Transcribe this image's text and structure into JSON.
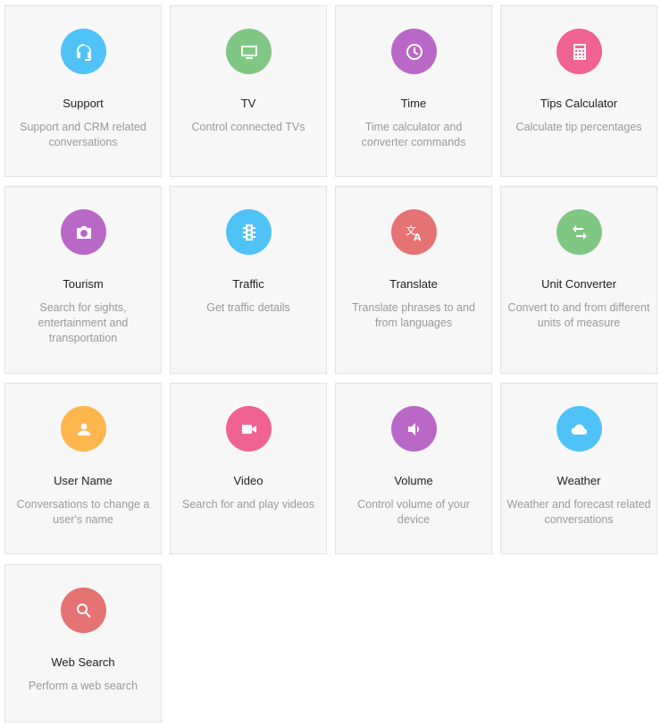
{
  "cards": [
    {
      "title": "Support",
      "description": "Support and CRM related conversations",
      "icon": "headset-icon",
      "color": "#4fc3f7"
    },
    {
      "title": "TV",
      "description": "Control connected TVs",
      "icon": "tv-icon",
      "color": "#81c784"
    },
    {
      "title": "Time",
      "description": "Time calculator and converter commands",
      "icon": "clock-icon",
      "color": "#ba68c8"
    },
    {
      "title": "Tips Calculator",
      "description": "Calculate tip percentages",
      "icon": "calculator-icon",
      "color": "#f06292"
    },
    {
      "title": "Tourism",
      "description": "Search for sights, entertainment and transportation",
      "icon": "camera-icon",
      "color": "#ba68c8"
    },
    {
      "title": "Traffic",
      "description": "Get traffic details",
      "icon": "traffic-light-icon",
      "color": "#4fc3f7"
    },
    {
      "title": "Translate",
      "description": "Translate phrases to and from languages",
      "icon": "translate-icon",
      "color": "#e57373"
    },
    {
      "title": "Unit Converter",
      "description": "Convert to and from different units of measure",
      "icon": "swap-arrows-icon",
      "color": "#81c784"
    },
    {
      "title": "User Name",
      "description": "Conversations to change a user's name",
      "icon": "person-icon",
      "color": "#ffb74d"
    },
    {
      "title": "Video",
      "description": "Search for and play videos",
      "icon": "video-camera-icon",
      "color": "#f06292"
    },
    {
      "title": "Volume",
      "description": "Control volume of your device",
      "icon": "speaker-icon",
      "color": "#ba68c8"
    },
    {
      "title": "Weather",
      "description": "Weather and forecast related conversations",
      "icon": "cloud-icon",
      "color": "#4fc3f7"
    },
    {
      "title": "Web Search",
      "description": "Perform a web search",
      "icon": "search-icon",
      "color": "#e57373"
    }
  ]
}
